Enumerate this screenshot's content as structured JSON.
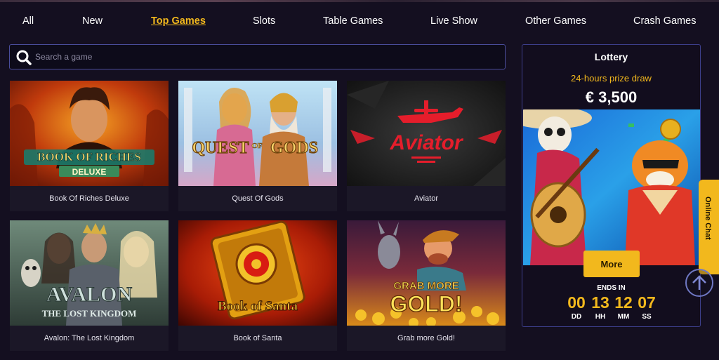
{
  "nav": {
    "items": [
      {
        "label": "All",
        "active": false
      },
      {
        "label": "New",
        "active": false
      },
      {
        "label": "Top Games",
        "active": true
      },
      {
        "label": "Slots",
        "active": false
      },
      {
        "label": "Table Games",
        "active": false
      },
      {
        "label": "Live Show",
        "active": false
      },
      {
        "label": "Other Games",
        "active": false
      },
      {
        "label": "Crash Games",
        "active": false
      }
    ]
  },
  "search": {
    "placeholder": "Search a game",
    "value": "",
    "icon": "search-icon"
  },
  "games": [
    {
      "title": "Book Of Riches Deluxe",
      "art_text": [
        "BOOK OF RICHES",
        "DELUXE"
      ]
    },
    {
      "title": "Quest Of Gods",
      "art_text": [
        "QUEST",
        "OF",
        "GODS"
      ]
    },
    {
      "title": "Aviator",
      "art_text": [
        "Aviator"
      ]
    },
    {
      "title": "Avalon: The Lost Kingdom",
      "art_text": [
        "AVALON",
        "THE LOST KINGDOM"
      ]
    },
    {
      "title": "Book of Santa",
      "art_text": [
        "Book of Santa"
      ]
    },
    {
      "title": "Grab more Gold!",
      "art_text": [
        "GRAB MORE",
        "GOLD!"
      ]
    }
  ],
  "lottery": {
    "title": "Lottery",
    "subtitle": "24-hours prize draw",
    "prize": "€ 3,500",
    "button_label": "More",
    "ends_label": "ENDS IN",
    "countdown": [
      {
        "value": "00",
        "unit": "DD"
      },
      {
        "value": "13",
        "unit": "HH"
      },
      {
        "value": "12",
        "unit": "MM"
      },
      {
        "value": "07",
        "unit": "SS"
      }
    ]
  },
  "chat": {
    "label": "Online Chat"
  },
  "colors": {
    "background": "#140f20",
    "accent": "#f2b81d",
    "border": "#4a4d9c",
    "card": "#1b1727"
  }
}
